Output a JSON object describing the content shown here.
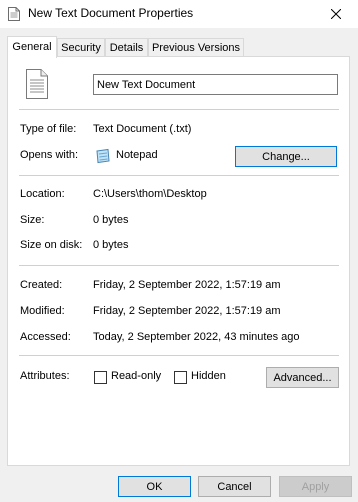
{
  "window": {
    "title": "New Text Document Properties"
  },
  "tabs": [
    {
      "label": "General",
      "active": true
    },
    {
      "label": "Security",
      "active": false
    },
    {
      "label": "Details",
      "active": false
    },
    {
      "label": "Previous Versions",
      "active": false
    }
  ],
  "general": {
    "file_name": "New Text Document",
    "type_label": "Type of file:",
    "type_value": "Text Document (.txt)",
    "opens_label": "Opens with:",
    "opens_value": "Notepad",
    "change_button": "Change...",
    "location_label": "Location:",
    "location_value": "C:\\Users\\thom\\Desktop",
    "size_label": "Size:",
    "size_value": "0 bytes",
    "size_disk_label": "Size on disk:",
    "size_disk_value": "0 bytes",
    "created_label": "Created:",
    "created_value": "Friday, 2 September 2022, 1:57:19 am",
    "modified_label": "Modified:",
    "modified_value": "Friday, 2 September 2022, 1:57:19 am",
    "accessed_label": "Accessed:",
    "accessed_value": "Today, 2 September 2022, 43 minutes ago",
    "attributes_label": "Attributes:",
    "readonly_label": "Read-only",
    "readonly_checked": false,
    "hidden_label": "Hidden",
    "hidden_checked": false,
    "advanced_button": "Advanced..."
  },
  "footer": {
    "ok": "OK",
    "cancel": "Cancel",
    "apply": "Apply"
  },
  "colors": {
    "accent": "#0078d7",
    "dialog_bg": "#f0f0f0",
    "panel_bg": "#ffffff"
  }
}
